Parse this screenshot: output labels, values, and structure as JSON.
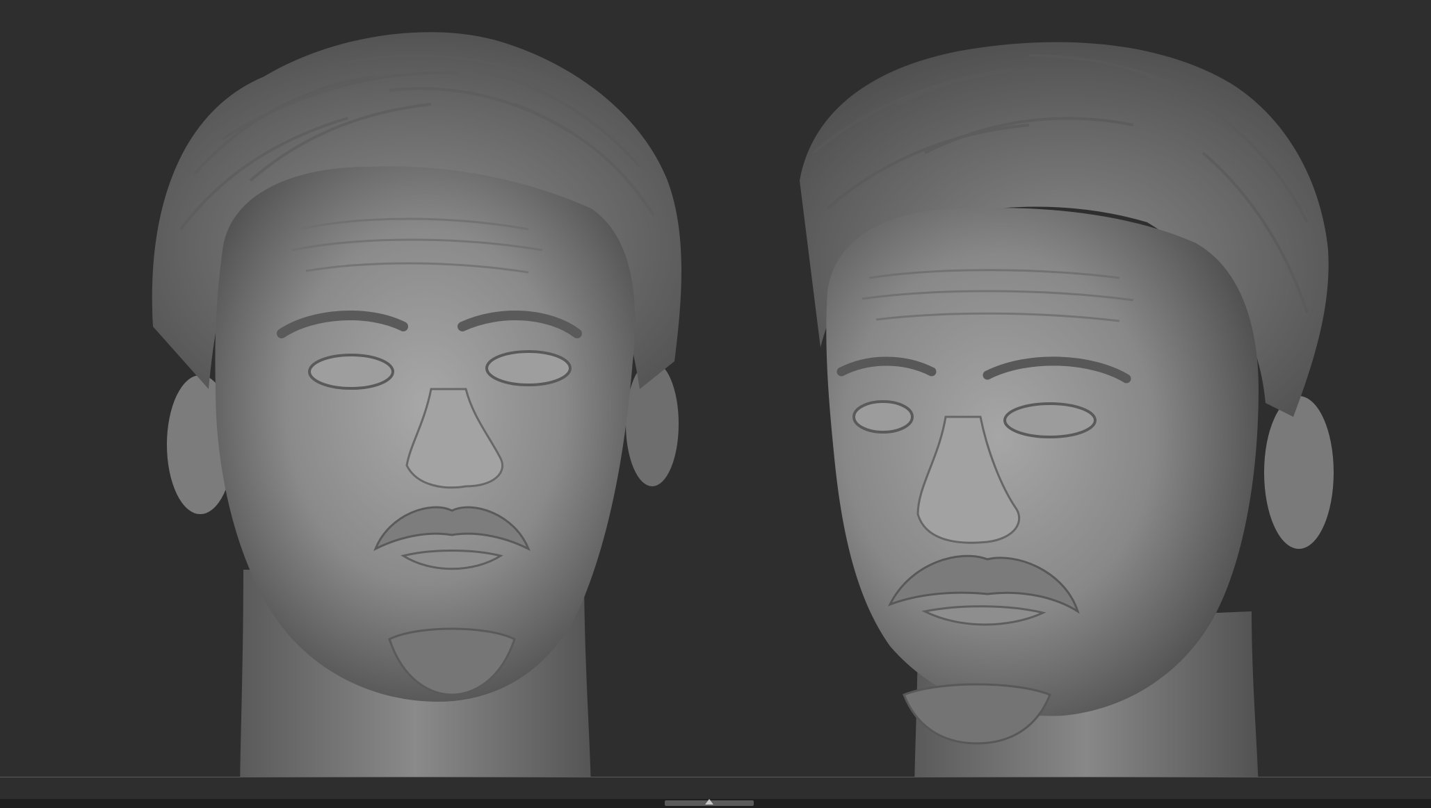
{
  "viewport": {
    "background_color": "#2e2e2e",
    "material": "clay-gray",
    "models": [
      {
        "name": "front-view",
        "subject": "sculpted-male-head"
      },
      {
        "name": "three-quarter-view",
        "subject": "sculpted-male-head"
      }
    ]
  },
  "timeline": {
    "handle_icon": "timeline-scrubber-icon",
    "track_color": "#5c5c5c"
  }
}
